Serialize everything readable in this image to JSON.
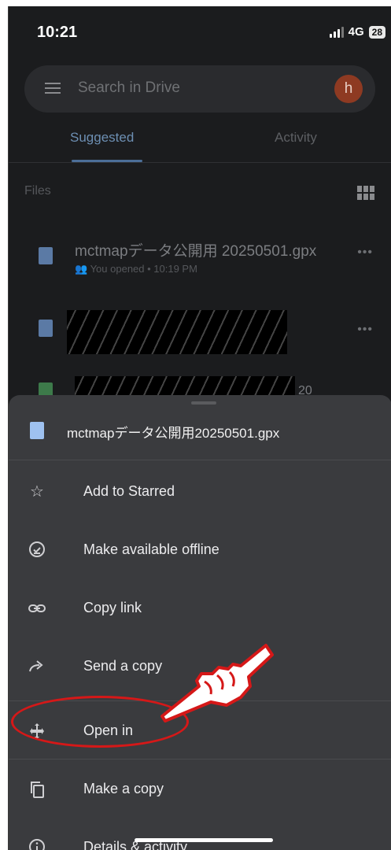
{
  "status_bar": {
    "time": "10:21",
    "network": "4G",
    "battery": "28"
  },
  "search": {
    "placeholder": "Search in Drive",
    "avatar_letter": "h"
  },
  "tabs": [
    {
      "label": "Suggested",
      "active": true
    },
    {
      "label": "Activity",
      "active": false
    }
  ],
  "files_section": {
    "label": "Files"
  },
  "files": [
    {
      "name": "mctmapデータ公開用 20250501.gpx",
      "meta": "You opened • 10:19 PM",
      "icon": "file-icon",
      "redacted": false
    },
    {
      "name": "",
      "meta": "",
      "icon": "document-icon",
      "redacted": true
    },
    {
      "name": "20",
      "meta": "",
      "icon": "spreadsheet-icon",
      "redacted": true
    }
  ],
  "sheet": {
    "file_name": "mctmapデータ公開用20250501.gpx",
    "items": [
      {
        "label": "Add to Starred",
        "icon": "star-icon"
      },
      {
        "label": "Make available offline",
        "icon": "offline-icon"
      },
      {
        "label": "Copy link",
        "icon": "link-icon"
      },
      {
        "label": "Send a copy",
        "icon": "share-arrow-icon"
      },
      {
        "label": "Open in",
        "icon": "open-in-move-icon"
      },
      {
        "label": "Make a copy",
        "icon": "copy-icon"
      },
      {
        "label": "Details & activity",
        "icon": "info-icon"
      }
    ]
  },
  "colors": {
    "accent": "#6d8fb3",
    "annotation": "#d51818",
    "sheet_bg": "#3a3b3e",
    "bg": "#1b1c1e"
  }
}
